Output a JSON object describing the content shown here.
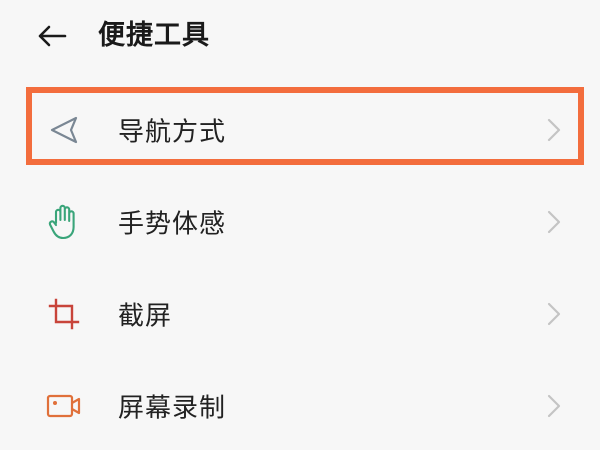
{
  "header": {
    "back_icon": "back-arrow-icon",
    "title": "便捷工具"
  },
  "menu": {
    "items": [
      {
        "label": "导航方式",
        "icon": "navigation-arrow-icon",
        "icon_color": "#7a8794",
        "highlighted": true
      },
      {
        "label": "手势体感",
        "icon": "hand-gesture-icon",
        "icon_color": "#3aa57a",
        "highlighted": false
      },
      {
        "label": "截屏",
        "icon": "crop-screenshot-icon",
        "icon_color": "#c8443a",
        "highlighted": false
      },
      {
        "label": "屏幕录制",
        "icon": "screen-record-icon",
        "icon_color": "#e0703a",
        "highlighted": false
      }
    ],
    "chevron_icon": "chevron-right-icon",
    "chevron_color": "#c4c4c4"
  },
  "colors": {
    "background": "#f7f7f7",
    "highlight_border": "#f36d3d",
    "text": "#222222"
  }
}
